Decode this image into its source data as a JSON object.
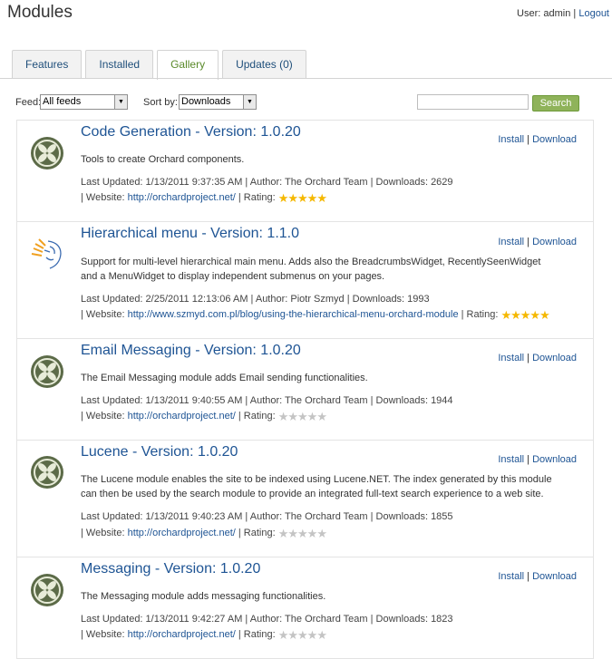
{
  "page": {
    "title": "Modules"
  },
  "user": {
    "label": "User:",
    "name": "admin",
    "logout": "Logout"
  },
  "tabs": [
    "Features",
    "Installed",
    "Gallery",
    "Updates (0)"
  ],
  "controls": {
    "feed_label": "Feed:",
    "feed_value": "All feeds",
    "sort_label": "Sort by:",
    "sort_value": "Downloads",
    "search_button": "Search"
  },
  "actions": {
    "install": "Install",
    "download": "Download"
  },
  "modules": [
    {
      "title": "Code Generation - Version: 1.0.20",
      "description": "Tools to create Orchard components.",
      "meta": "Last Updated: 1/13/2011 9:37:35 AM | Author: The Orchard Team | Downloads: 2629",
      "website_label": "| Website:",
      "website": "http://orchardproject.net/",
      "rating_label": "| Rating:",
      "rating": 5,
      "icon": "orchard-logo-icon"
    },
    {
      "title": "Hierarchical menu - Version: 1.1.0",
      "description": "Support for multi-level hierarchical main menu. Adds also the BreadcrumbsWidget, RecentlySeenWidget and a MenuWidget to display independent submenus on your pages.",
      "meta": "Last Updated: 2/25/2011 12:13:06 AM | Author: Piotr Szmyd | Downloads: 1993",
      "website_label": "| Website:",
      "website": "http://www.szmyd.com.pl/blog/using-the-hierarchical-menu-orchard-module",
      "rating_label": "| Rating:",
      "rating": 5,
      "icon": "face-sketch-icon"
    },
    {
      "title": "Email Messaging - Version: 1.0.20",
      "description": "The Email Messaging module adds Email sending functionalities.",
      "meta": "Last Updated: 1/13/2011 9:40:55 AM | Author: The Orchard Team | Downloads: 1944",
      "website_label": "| Website:",
      "website": "http://orchardproject.net/",
      "rating_label": "| Rating:",
      "rating": 0,
      "icon": "orchard-logo-icon"
    },
    {
      "title": "Lucene - Version: 1.0.20",
      "description": "The Lucene module enables the site to be indexed using Lucene.NET. The index generated by this module can then be used by the search module to provide an integrated full-text search experience to a web site.",
      "meta": "Last Updated: 1/13/2011 9:40:23 AM | Author: The Orchard Team | Downloads: 1855",
      "website_label": "| Website:",
      "website": "http://orchardproject.net/",
      "rating_label": "| Rating:",
      "rating": 0,
      "icon": "orchard-logo-icon"
    },
    {
      "title": "Messaging - Version: 1.0.20",
      "description": "The Messaging module adds messaging functionalities.",
      "meta": "Last Updated: 1/13/2011 9:42:27 AM | Author: The Orchard Team | Downloads: 1823",
      "website_label": "| Website:",
      "website": "http://orchardproject.net/",
      "rating_label": "| Rating:",
      "rating": 0,
      "icon": "orchard-logo-icon"
    }
  ],
  "colors": {
    "link": "#1e5494",
    "accent": "#8fb35a",
    "star_gold": "#f5b800",
    "star_grey": "#c4c4c4"
  }
}
